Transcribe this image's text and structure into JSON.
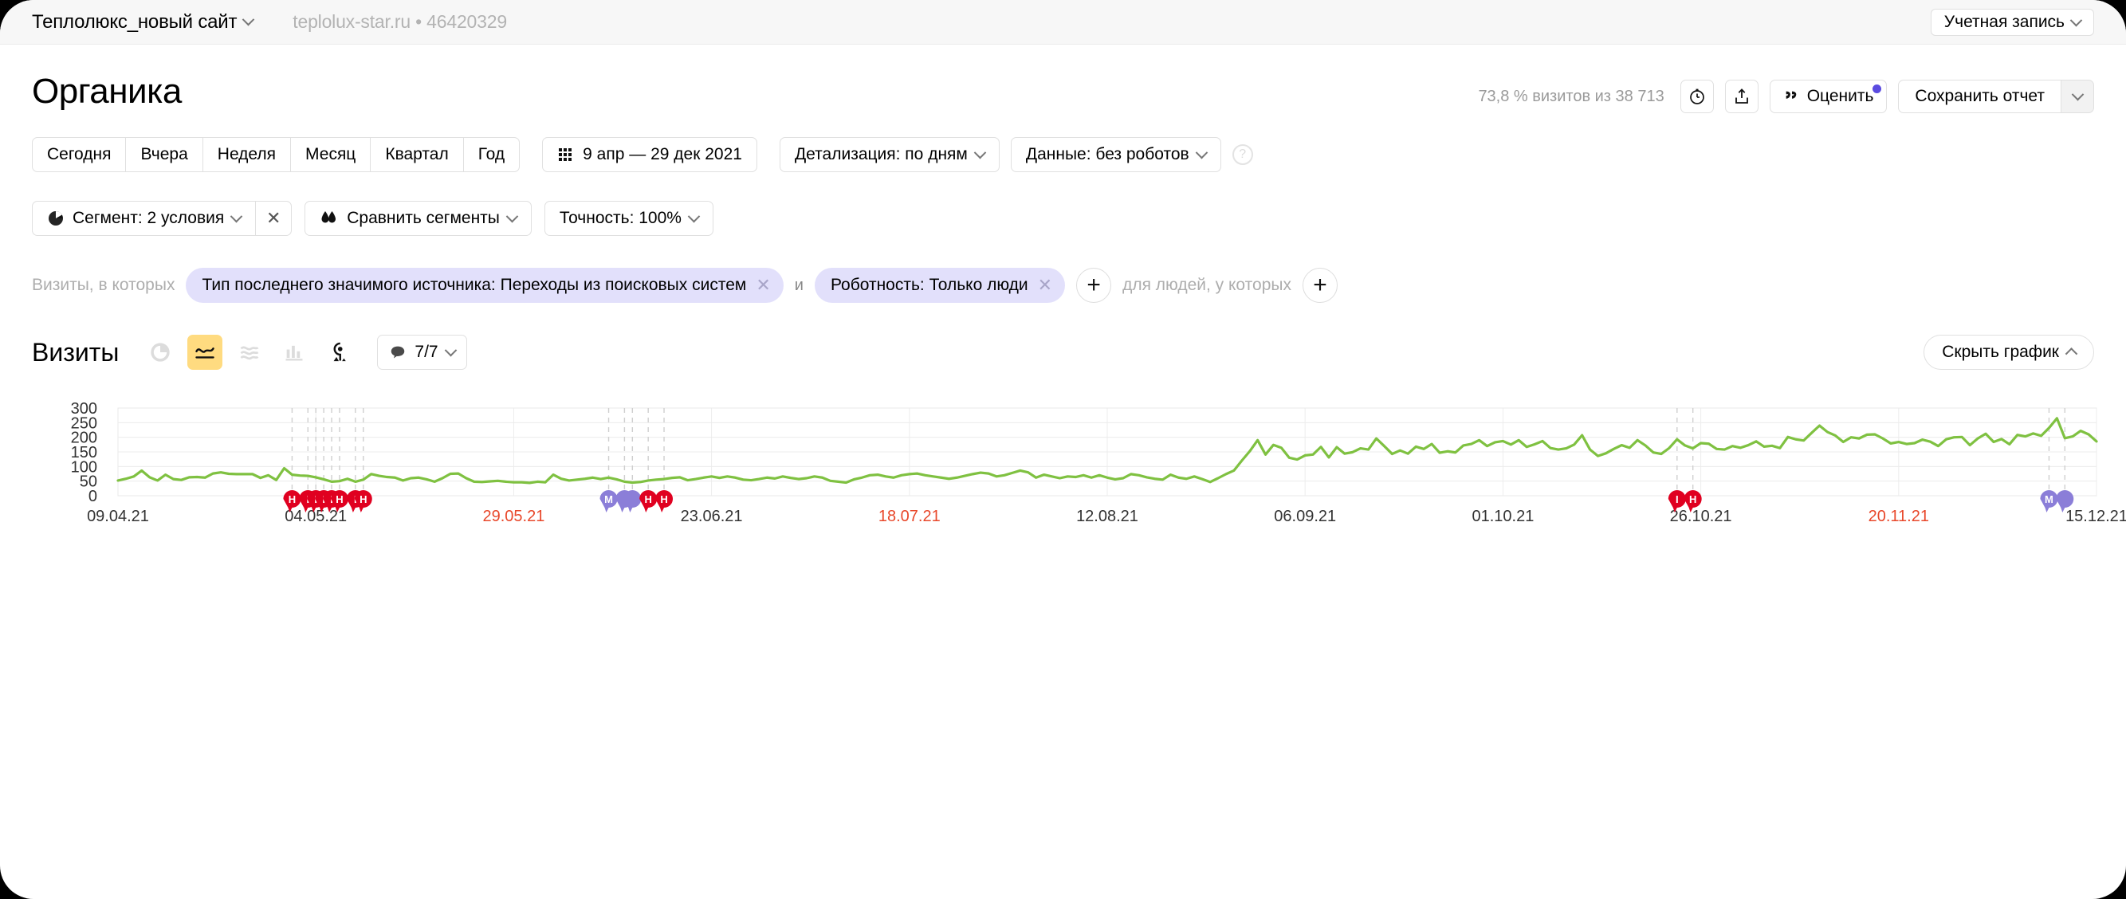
{
  "topbar": {
    "site_name": "Теплолюкс_новый сайт",
    "site_meta": "teplolux-star.ru • 46420329",
    "account_label": "Учетная запись"
  },
  "header": {
    "title": "Органика",
    "visits_stat": "73,8 % визитов из 38 713",
    "rate_label": "Оценить",
    "save_label": "Сохранить отчет",
    "icons": {
      "clock": "clock-icon",
      "export": "export-icon"
    }
  },
  "period": {
    "buttons": [
      "Сегодня",
      "Вчера",
      "Неделя",
      "Месяц",
      "Квартал",
      "Год"
    ],
    "date_range": "9 апр — 29 дек 2021",
    "detail": "Детализация: по дням",
    "data": "Данные: без роботов",
    "help": "?"
  },
  "segments": {
    "segment": "Сегмент: 2 условия",
    "clear": "✕",
    "compare": "Сравнить сегменты",
    "accuracy": "Точность: 100%"
  },
  "filters": {
    "prefix": "Визиты, в которых",
    "chips": [
      "Тип последнего значимого источника: Переходы из поисковых систем",
      "Роботность: Только люди"
    ],
    "conjunction": "и",
    "add": "+",
    "people_prefix": "для людей, у которых",
    "add2": "+"
  },
  "metric": {
    "title": "Визиты",
    "viz_buttons": [
      {
        "name": "pie-chart-icon",
        "active": false,
        "disabled": true
      },
      {
        "name": "line-chart-icon",
        "active": true,
        "disabled": false
      },
      {
        "name": "area-chart-icon",
        "active": false,
        "disabled": true
      },
      {
        "name": "bar-chart-icon",
        "active": false,
        "disabled": true
      },
      {
        "name": "map-pin-icon",
        "active": false,
        "disabled": false
      }
    ],
    "comments": "7/7",
    "hide_chart": "Скрыть график"
  },
  "colors": {
    "line": "#7fc141",
    "accent": "#ffdb80",
    "chip": "#e2e0fb",
    "holiday_marker": "#e00020",
    "event_marker": "#8b7ed8",
    "red_label": "#e8472a"
  },
  "chart_data": {
    "type": "line",
    "title": "Визиты",
    "xlabel": "",
    "ylabel": "",
    "ylim": [
      0,
      300
    ],
    "yticks": [
      0,
      50,
      100,
      150,
      200,
      250,
      300
    ],
    "grid": true,
    "legend": "none",
    "xticks": [
      {
        "label": "09.04.21",
        "red": false
      },
      {
        "label": "04.05.21",
        "red": false
      },
      {
        "label": "29.05.21",
        "red": true
      },
      {
        "label": "23.06.21",
        "red": false
      },
      {
        "label": "18.07.21",
        "red": true
      },
      {
        "label": "12.08.21",
        "red": false
      },
      {
        "label": "06.09.21",
        "red": false
      },
      {
        "label": "01.10.21",
        "red": false
      },
      {
        "label": "26.10.21",
        "red": false
      },
      {
        "label": "20.11.21",
        "red": true
      },
      {
        "label": "15.12.21",
        "red": false
      }
    ],
    "x_start": "09.04.21",
    "x_end": "29.12.21",
    "series": [
      {
        "name": "Визиты",
        "color": "#7fc141",
        "values": [
          52,
          58,
          66,
          86,
          63,
          52,
          72,
          57,
          54,
          63,
          64,
          62,
          76,
          80,
          75,
          74,
          74,
          74,
          61,
          70,
          54,
          94,
          72,
          69,
          68,
          63,
          56,
          48,
          50,
          58,
          48,
          55,
          74,
          68,
          64,
          62,
          52,
          60,
          62,
          56,
          48,
          60,
          75,
          76,
          60,
          48,
          47,
          49,
          51,
          48,
          46,
          46,
          44,
          48,
          46,
          72,
          58,
          52,
          55,
          58,
          62,
          57,
          62,
          56,
          48,
          45,
          47,
          52,
          55,
          57,
          61,
          63,
          53,
          57,
          62,
          66,
          61,
          66,
          62,
          55,
          53,
          57,
          62,
          59,
          66,
          61,
          57,
          60,
          66,
          62,
          51,
          48,
          45,
          56,
          62,
          70,
          72,
          66,
          62,
          70,
          74,
          76,
          70,
          66,
          62,
          58,
          62,
          68,
          74,
          79,
          76,
          66,
          70,
          78,
          86,
          80,
          62,
          72,
          66,
          60,
          66,
          64,
          70,
          62,
          70,
          62,
          56,
          60,
          74,
          70,
          63,
          58,
          55,
          72,
          62,
          58,
          66,
          57,
          47,
          60,
          74,
          86,
          120,
          152,
          190,
          141,
          174,
          164,
          130,
          124,
          138,
          141,
          167,
          131,
          166,
          144,
          149,
          162,
          158,
          196,
          170,
          143,
          155,
          144,
          168,
          160,
          177,
          147,
          152,
          148,
          172,
          177,
          190,
          170,
          183,
          187,
          175,
          190,
          167,
          176,
          187,
          163,
          158,
          162,
          175,
          207,
          158,
          136,
          145,
          160,
          173,
          164,
          190,
          172,
          148,
          143,
          163,
          193,
          172,
          162,
          180,
          178,
          160,
          158,
          170,
          164,
          173,
          186,
          168,
          171,
          163,
          201,
          193,
          189,
          215,
          240,
          218,
          206,
          184,
          200,
          196,
          209,
          210,
          196,
          179,
          184,
          177,
          180,
          192,
          185,
          170,
          193,
          200,
          201,
          173,
          196,
          212,
          184,
          194,
          176,
          208,
          203,
          213,
          205,
          232,
          265,
          197,
          203,
          222,
          210,
          186
        ]
      }
    ],
    "markers": [
      {
        "x_index": 22,
        "type": "holiday",
        "label": "H"
      },
      {
        "x_index": 24,
        "type": "holiday",
        "label": "I"
      },
      {
        "x_index": 25,
        "type": "holiday",
        "label": "I"
      },
      {
        "x_index": 26,
        "type": "holiday",
        "label": "I"
      },
      {
        "x_index": 27,
        "type": "holiday",
        "label": "I"
      },
      {
        "x_index": 28,
        "type": "holiday",
        "label": "H"
      },
      {
        "x_index": 30,
        "type": "holiday",
        "label": "I"
      },
      {
        "x_index": 31,
        "type": "holiday",
        "label": "H"
      },
      {
        "x_index": 62,
        "type": "event",
        "label": "M"
      },
      {
        "x_index": 64,
        "type": "event",
        "label": ""
      },
      {
        "x_index": 65,
        "type": "event",
        "label": ""
      },
      {
        "x_index": 67,
        "type": "holiday",
        "label": "H"
      },
      {
        "x_index": 69,
        "type": "holiday",
        "label": "H"
      },
      {
        "x_index": 197,
        "type": "holiday",
        "label": "I"
      },
      {
        "x_index": 199,
        "type": "holiday",
        "label": "H"
      },
      {
        "x_index": 244,
        "type": "event",
        "label": "M"
      },
      {
        "x_index": 246,
        "type": "event",
        "label": ""
      }
    ]
  }
}
